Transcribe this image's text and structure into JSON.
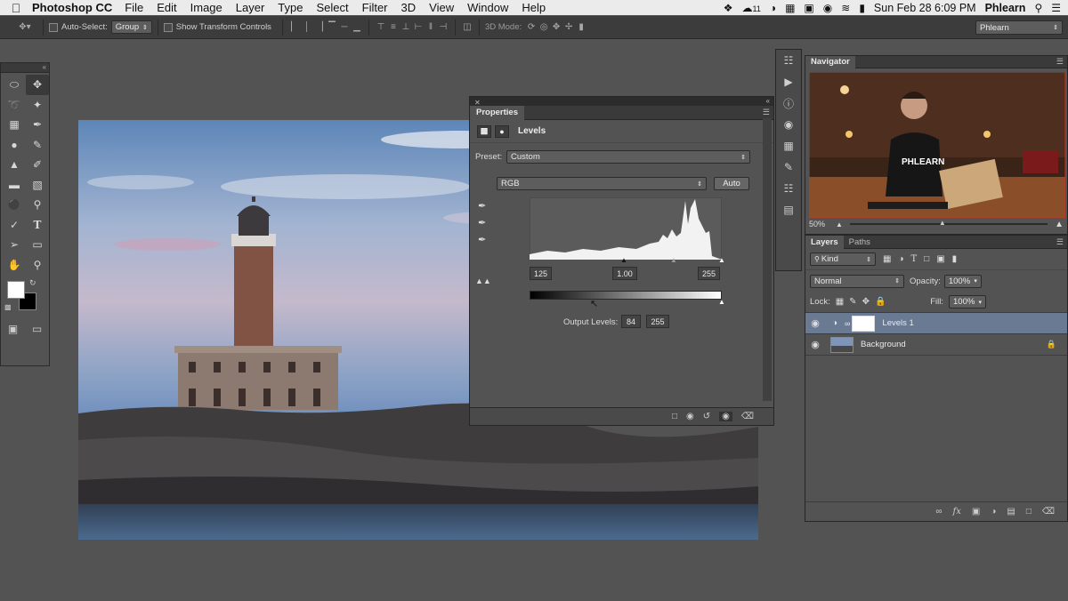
{
  "menubar": {
    "app_name": "Photoshop CC",
    "items": [
      "File",
      "Edit",
      "Image",
      "Layer",
      "Type",
      "Select",
      "Filter",
      "3D",
      "View",
      "Window",
      "Help"
    ],
    "badge_count": "11",
    "datetime": "Sun Feb 28  6:09 PM",
    "user": "Phlearn"
  },
  "options": {
    "auto_select_label": "Auto-Select:",
    "auto_select_value": "Group",
    "show_transform_label": "Show Transform Controls",
    "mode_3d_label": "3D Mode:",
    "workspace": "Phlearn"
  },
  "properties": {
    "tab": "Properties",
    "title": "Levels",
    "preset_label": "Preset:",
    "preset_value": "Custom",
    "channel_value": "RGB",
    "auto_label": "Auto",
    "input_black": "125",
    "input_gamma": "1.00",
    "input_white": "255",
    "output_label": "Output Levels:",
    "output_black": "84",
    "output_white": "255"
  },
  "navigator": {
    "tab": "Navigator",
    "zoom": "50%"
  },
  "layers": {
    "tabs": [
      "Layers",
      "Paths"
    ],
    "filter_value": "Kind",
    "blend_mode": "Normal",
    "opacity_label": "Opacity:",
    "opacity_value": "100%",
    "lock_label": "Lock:",
    "fill_label": "Fill:",
    "fill_value": "100%",
    "items": [
      {
        "name": "Levels 1",
        "selected": true
      },
      {
        "name": "Background",
        "selected": false
      }
    ]
  },
  "colors": {
    "panel": "#535353",
    "dark": "#3c3c3c",
    "selection": "#6a7a93",
    "menubar": "#ebebeb"
  }
}
